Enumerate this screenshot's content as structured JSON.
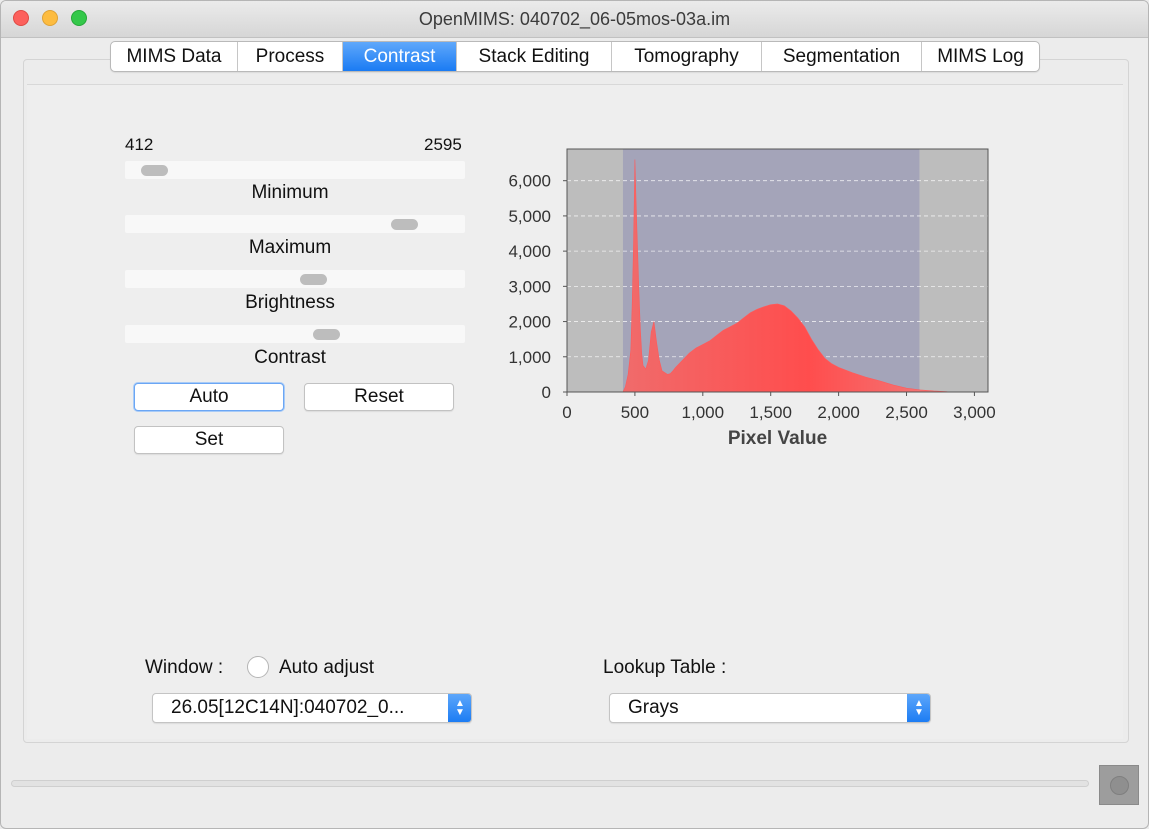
{
  "window": {
    "title": "OpenMIMS: 040702_06-05mos-03a.im"
  },
  "tabs": [
    {
      "label": "MIMS Data",
      "active": false
    },
    {
      "label": "Process",
      "active": false
    },
    {
      "label": "Contrast",
      "active": true
    },
    {
      "label": "Stack Editing",
      "active": false
    },
    {
      "label": "Tomography",
      "active": false
    },
    {
      "label": "Segmentation",
      "active": false
    },
    {
      "label": "MIMS Log",
      "active": false
    }
  ],
  "contrast": {
    "min_value": "412",
    "max_value": "2595",
    "sliders": [
      {
        "label": "Minimum",
        "level": 0.05
      },
      {
        "label": "Maximum",
        "level": 0.85
      },
      {
        "label": "Brightness",
        "level": 0.56
      },
      {
        "label": "Contrast",
        "level": 0.6
      }
    ],
    "buttons": {
      "auto": "Auto",
      "reset": "Reset",
      "set": "Set"
    }
  },
  "controls": {
    "window_label": "Window :",
    "auto_adjust_label": "Auto adjust",
    "auto_adjust_checked": false,
    "window_select_value": "26.05[12C14N]:040702_0...",
    "lookup_label": "Lookup Table :",
    "lookup_select_value": "Grays"
  },
  "colors": {
    "accent": "#1a7bf3",
    "histogram_fill": "#ff5a5a",
    "selected_range": "#a4a4b9",
    "plot_background": "#bdbdbd"
  },
  "chart_data": {
    "type": "area",
    "title": "",
    "xlabel": "Pixel Value",
    "ylabel": "",
    "xlim": [
      0,
      3100
    ],
    "ylim": [
      0,
      6900
    ],
    "x_ticks": [
      "0",
      "500",
      "1,000",
      "1,500",
      "2,000",
      "2,500",
      "3,000"
    ],
    "y_ticks": [
      "0",
      "1,000",
      "2,000",
      "3,000",
      "4,000",
      "5,000",
      "6,000"
    ],
    "grid": "horizontal dashed",
    "selected_range": [
      412,
      2595
    ],
    "series": [
      {
        "x": [
          412,
          430,
          450,
          470,
          480,
          490,
          500,
          510,
          520,
          530,
          540,
          550,
          560,
          580,
          600,
          620,
          640,
          660,
          680,
          700,
          720,
          740,
          760,
          780,
          800,
          850,
          900,
          950,
          1000,
          1050,
          1100,
          1150,
          1200,
          1250,
          1300,
          1350,
          1400,
          1450,
          1500,
          1550,
          1600,
          1650,
          1700,
          1750,
          1800,
          1850,
          1900,
          1950,
          2000,
          2100,
          2200,
          2300,
          2400,
          2500,
          2600,
          2700,
          2800,
          2900
        ],
        "y": [
          0,
          150,
          500,
          1200,
          2500,
          4200,
          6600,
          5200,
          4000,
          2800,
          1800,
          1100,
          750,
          650,
          900,
          1700,
          2000,
          1400,
          900,
          600,
          550,
          500,
          520,
          600,
          700,
          900,
          1100,
          1250,
          1350,
          1450,
          1600,
          1750,
          1850,
          1950,
          2100,
          2250,
          2350,
          2420,
          2480,
          2500,
          2450,
          2300,
          2100,
          1850,
          1500,
          1200,
          950,
          800,
          700,
          550,
          420,
          320,
          200,
          110,
          60,
          30,
          10,
          0
        ]
      }
    ]
  }
}
